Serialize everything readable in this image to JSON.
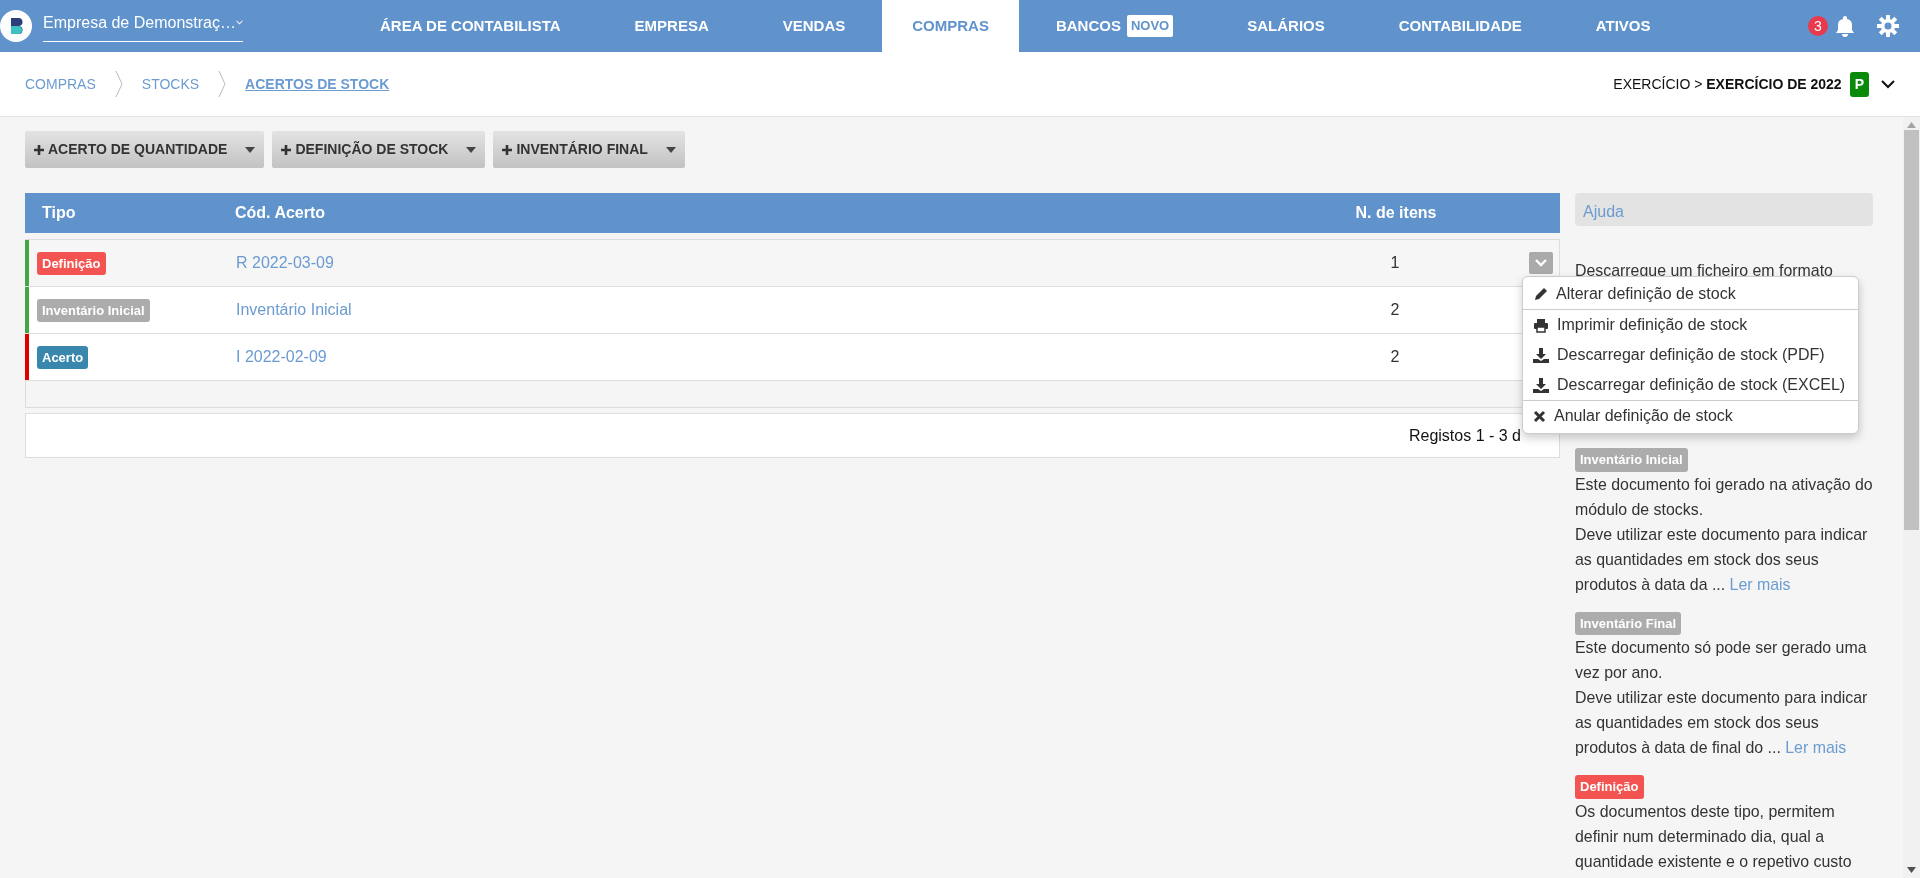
{
  "topbar": {
    "company": "Empresa de Demonstraç…",
    "nav": [
      {
        "label": "ÁREA DE CONTABILISTA",
        "selected": false
      },
      {
        "label": "EMPRESA",
        "selected": false
      },
      {
        "label": "VENDAS",
        "selected": false
      },
      {
        "label": "COMPRAS",
        "selected": true
      },
      {
        "label": "BANCOS",
        "badge": "NOVO",
        "selected": false
      },
      {
        "label": "SALÁRIOS",
        "selected": false
      },
      {
        "label": "CONTABILIDADE",
        "selected": false
      },
      {
        "label": "ATIVOS",
        "selected": false
      }
    ],
    "notifications": "3"
  },
  "breadcrumb": [
    {
      "label": "COMPRAS",
      "selected": false
    },
    {
      "label": "STOCKS",
      "selected": false
    },
    {
      "label": "ACERTOS DE STOCK",
      "selected": true
    }
  ],
  "fiscal_year": {
    "label": "EXERCÍCIO > **EXERCÍCIO DE 2022**",
    "badge": "P"
  },
  "actions": [
    "ACERTO DE QUANTIDADE",
    "DEFINIÇÃO DE STOCK",
    "INVENTÁRIO FINAL"
  ],
  "table": {
    "columns": [
      "Tipo",
      "Cód. Acerto",
      "N. de itens"
    ],
    "rows": [
      {
        "tag": {
          "label": "Definição",
          "color": "#f35451"
        },
        "code": "R 2022-03-09",
        "items": "1",
        "color": "#43a843",
        "menu_open": true
      },
      {
        "tag": {
          "label": "Inventário Inicial",
          "color": "#acacac"
        },
        "code": "Inventário Inicial",
        "items": "2",
        "color": "#43a843",
        "menu_open": false
      },
      {
        "tag": {
          "label": "Acerto",
          "color": "#3a87ad"
        },
        "code": "I 2022-02-09",
        "items": "2",
        "color": "#e00000",
        "menu_open": false
      }
    ],
    "pagination": "Registos 1 - 3 d"
  },
  "row_menu": {
    "groups": [
      {
        "items": [
          {
            "kind": "edit",
            "label": "Alterar definição de stock"
          }
        ]
      },
      {
        "items": [
          {
            "kind": "print",
            "label": "Imprimir definição de stock"
          },
          {
            "kind": "download",
            "label": "Descarregar definição de stock (PDF)"
          },
          {
            "kind": "download",
            "label": "Descarregar definição de stock (EXCEL)"
          }
        ]
      },
      {
        "items": [
          {
            "kind": "cancel",
            "label": "Anular definição de stock"
          }
        ]
      }
    ]
  },
  "help": {
    "title": "Ajuda",
    "intro": "Descarregue um ficheiro em formato",
    "sections": [
      {
        "tag": {
          "label": "Inventário Inicial",
          "color": "#acacac"
        },
        "paragraphs": [
          "Este documento foi gerado na ativação do módulo de stocks.",
          "Deve utilizar este documento para indicar as quantidades em stock dos seus produtos à data da ..."
        ],
        "link": "Ler mais"
      },
      {
        "tag": {
          "label": "Inventário Final",
          "color": "#acacac"
        },
        "paragraphs": [
          "Este documento só pode ser gerado uma vez por ano.",
          "Deve utilizar este documento para indicar as quantidades em stock dos seus produtos à data de final do ..."
        ],
        "link": "Ler mais"
      },
      {
        "tag": {
          "label": "Definição",
          "color": "#f35451"
        },
        "paragraphs": [
          "Os documentos deste tipo, permitem definir num determinado dia, qual a quantidade existente e o repetivo custo"
        ]
      }
    ]
  }
}
